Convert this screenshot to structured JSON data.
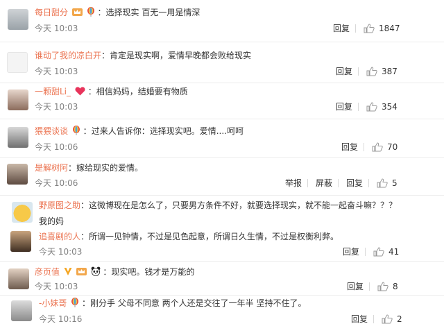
{
  "comments": [
    {
      "user": "每日甜分",
      "text": "选择现实 百无一用是情深",
      "time": "今天 10:03",
      "reply": "回复",
      "likes": "1847"
    },
    {
      "user": "谁动了我的凉白开",
      "text": "肯定是现实啊，爱情早晚都会败给现实",
      "time": "今天 10:03",
      "reply": "回复",
      "likes": "387"
    },
    {
      "user": "一颗甜Li_",
      "text": "相信妈妈，结婚要有物质",
      "time": "今天 10:03",
      "reply": "回复",
      "likes": "354"
    },
    {
      "user": "猥猥谈谈",
      "text": "过来人告诉你：选择现实吧。爱情....呵呵",
      "time": "今天 10:06",
      "reply": "回复",
      "likes": "70"
    },
    {
      "user": "是解树阿",
      "text": "嫁给现实的爱情。",
      "time": "今天 10:06",
      "report": "举报",
      "block": "屏蔽",
      "reply": "回复",
      "likes": "5"
    },
    {
      "user": "野原图之助",
      "text": "这微博现在是怎么了，只要男方条件不好，就要选择现实，就不能一起奋斗嘛？？？",
      "text2": "我的妈"
    },
    {
      "user": "追喜剧的人",
      "text": "所谓一见钟情，不过是见色起意，所谓日久生情，不过是权衡利弊。",
      "time": "今天 10:03",
      "reply": "回复",
      "likes": "41"
    },
    {
      "user": "彦页值",
      "text": "现实吧。钱才是万能的",
      "time": "今天 10:03",
      "reply": "回复",
      "likes": "8"
    },
    {
      "user": "-小妹哥",
      "text": "刚分手 父母不同意 两个人还是交往了一年半 坚持不住了。",
      "time": "今天 10:16",
      "reply": "回复",
      "likes": "2"
    }
  ],
  "colon": "：",
  "colors": {
    "username": "#eb7350",
    "text": "#333333",
    "meta": "#808080"
  },
  "icons": [
    "crown-icon",
    "rainbow-balloon-icon",
    "heart-icon",
    "vip-v-icon",
    "panda-icon",
    "thumb-up-icon"
  ]
}
